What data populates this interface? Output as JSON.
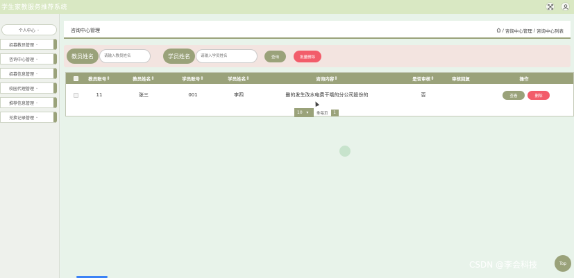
{
  "app": {
    "title": "学生家教服务推荐系统"
  },
  "topbar_icons": {
    "fullscreen": "fullscreen-icon",
    "user": "user-icon"
  },
  "sidebar": {
    "items": [
      {
        "label": "个人中心"
      },
      {
        "label": "招募教员管理"
      },
      {
        "label": "咨询中心管理"
      },
      {
        "label": "招募信息管理"
      },
      {
        "label": "校园代理管理"
      },
      {
        "label": "推荐信息管理"
      },
      {
        "label": "兑换记录管理"
      }
    ]
  },
  "breadcrumb": {
    "page_title": "咨询中心管理",
    "path_1": "咨询中心管理",
    "path_2": "咨询中心列表",
    "separator": "/"
  },
  "search": {
    "teacher_name_label": "教员姓名",
    "teacher_name_placeholder": "请输入教员姓名",
    "student_name_label": "学员姓名",
    "student_name_placeholder": "请输入学员姓名",
    "search_button": "查询",
    "batch_delete_button": "批量删除"
  },
  "table": {
    "columns": [
      "教员账号",
      "教员姓名",
      "学员账号",
      "学员姓名",
      "咨询内容",
      "是否审核",
      "审核回复",
      "操作"
    ],
    "rows": [
      {
        "teacher_account": "11",
        "teacher_name": "张三",
        "student_account": "001",
        "student_name": "李四",
        "content": "删的发生改水电费干哦的分公司股份的",
        "reviewed": "否",
        "review_reply": "",
        "view_button": "查看",
        "delete_button": "删除"
      }
    ]
  },
  "pagination": {
    "page_size": "10",
    "per_page_label": "条每页",
    "current_page": "1"
  },
  "watermark": "CSDN @李会科技",
  "back_to_top": "Top",
  "colors": {
    "primary": "#9aa27a",
    "danger": "#f25c6a",
    "search_bg": "#f3e4e0",
    "topbar": "#d9e8c3"
  }
}
